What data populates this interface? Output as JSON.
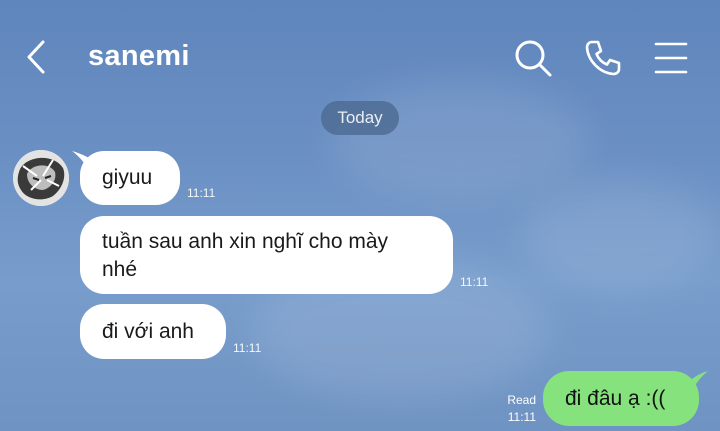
{
  "header": {
    "title": "sanemi",
    "back_icon": "chevron-left-icon",
    "search_icon": "search-icon",
    "call_icon": "phone-icon",
    "menu_icon": "hamburger-menu-icon"
  },
  "date_separator": "Today",
  "messages": [
    {
      "from": "sanemi",
      "text": "giyuu",
      "time": "11:11"
    },
    {
      "from": "sanemi",
      "line1": "tuần sau anh xin nghĩ cho mày",
      "line2": "nhé",
      "time": "11:11"
    },
    {
      "from": "sanemi",
      "text": "đi với anh",
      "time": "11:11"
    },
    {
      "from": "me",
      "text": "đi đâu ạ :((",
      "status": "Read",
      "time": "11:11"
    }
  ],
  "colors": {
    "background": "#6a8fc3",
    "incoming_bubble": "#ffffff",
    "outgoing_bubble": "#85e27c",
    "date_pill": "#4a678d"
  }
}
